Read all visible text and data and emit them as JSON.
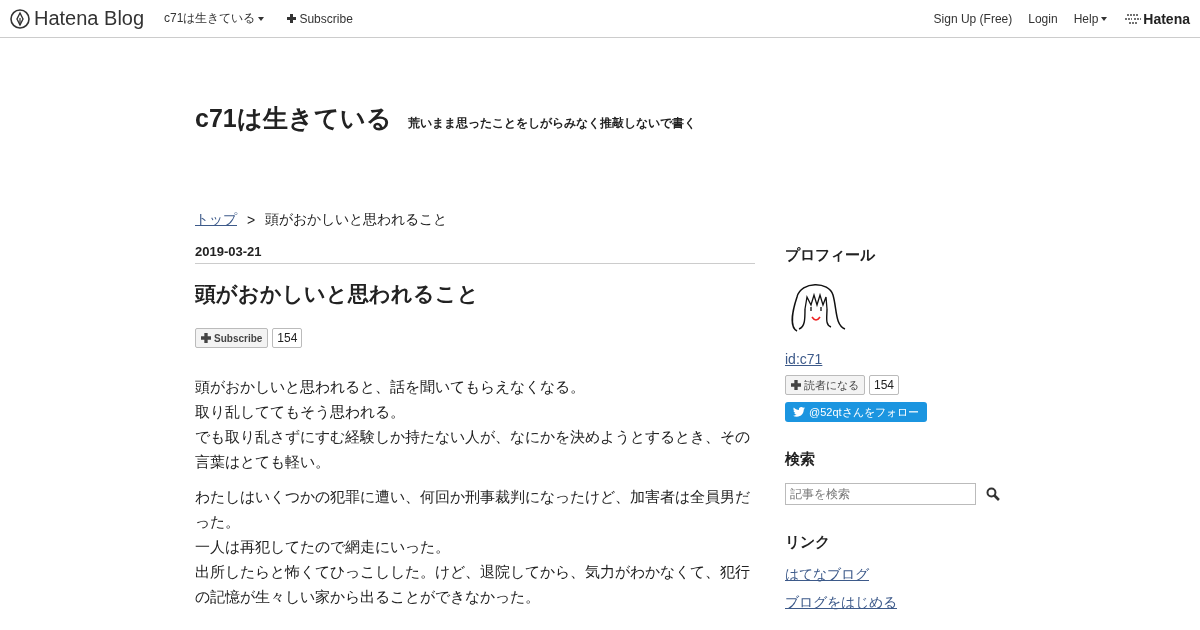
{
  "topbar": {
    "logo": "Hatena Blog",
    "blog_menu": "c71は生きている",
    "subscribe": "Subscribe",
    "links": [
      "Sign Up (Free)",
      "Login"
    ],
    "help": "Help",
    "brand": "Hatena"
  },
  "blog": {
    "title": "c71は生きている",
    "description": "荒いまま思ったことをしがらみなく推敲しないで書く"
  },
  "breadcrumb": {
    "home": "トップ",
    "separator": ">",
    "current": "頭がおかしいと思われること"
  },
  "entry": {
    "date": "2019-03-21",
    "title": "頭がおかしいと思われること",
    "subscribe": "Subscribe",
    "count": "154",
    "paragraphs": [
      [
        "頭がおかしいと思われると、話を聞いてもらえなくなる。",
        "取り乱しててもそう思われる。",
        "でも取り乱さずにすむ経験しか持たない人が、なにかを決めようとするとき、その言葉はとても軽い。"
      ],
      [
        "わたしはいくつかの犯罪に遭い、何回か刑事裁判になったけど、加害者は全員男だった。",
        "一人は再犯してたので網走にいった。",
        "出所したらと怖くてひっこしした。けど、退院してから、気力がわかなくて、犯行の記憶が生々しい家から出ることができなかった。"
      ]
    ]
  },
  "sidebar": {
    "profile": {
      "heading": "プロフィール",
      "id": "id:c71",
      "subscribe": "読者になる",
      "count": "154",
      "follow": "@52qtさんをフォロー"
    },
    "search": {
      "heading": "検索",
      "placeholder": "記事を検索"
    },
    "links": {
      "heading": "リンク",
      "items": [
        "はてなブログ",
        "ブログをはじめる"
      ]
    }
  }
}
